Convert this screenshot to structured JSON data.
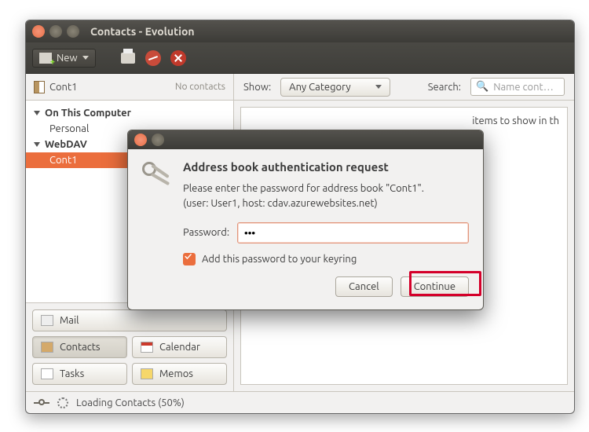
{
  "window": {
    "title": "Contacts - Evolution"
  },
  "toolbar": {
    "new_label": "New"
  },
  "sidebar": {
    "current_book": "Cont1",
    "no_contacts": "No contacts",
    "groups": [
      {
        "label": "On This Computer",
        "children": [
          {
            "label": "Personal",
            "selected": false
          }
        ]
      },
      {
        "label": "WebDAV",
        "children": [
          {
            "label": "Cont1",
            "selected": true
          }
        ]
      }
    ],
    "nav": {
      "mail": "Mail",
      "contacts": "Contacts",
      "calendar": "Calendar",
      "tasks": "Tasks",
      "memos": "Memos"
    }
  },
  "filter": {
    "show_label": "Show:",
    "category": "Any Category",
    "search_label": "Search:",
    "search_placeholder": "Name cont…"
  },
  "main": {
    "empty_message": "items to show in th"
  },
  "status": {
    "text": "Loading Contacts (50%)"
  },
  "dialog": {
    "title": "Address book authentication request",
    "body_line1": "Please enter the password for address book \"Cont1\".",
    "body_line2": "(user: User1, host: cdav.azurewebsites.net)",
    "password_label": "Password:",
    "password_value": "•••",
    "keyring_label": "Add this password to your keyring",
    "cancel": "Cancel",
    "continue": "Continue"
  }
}
